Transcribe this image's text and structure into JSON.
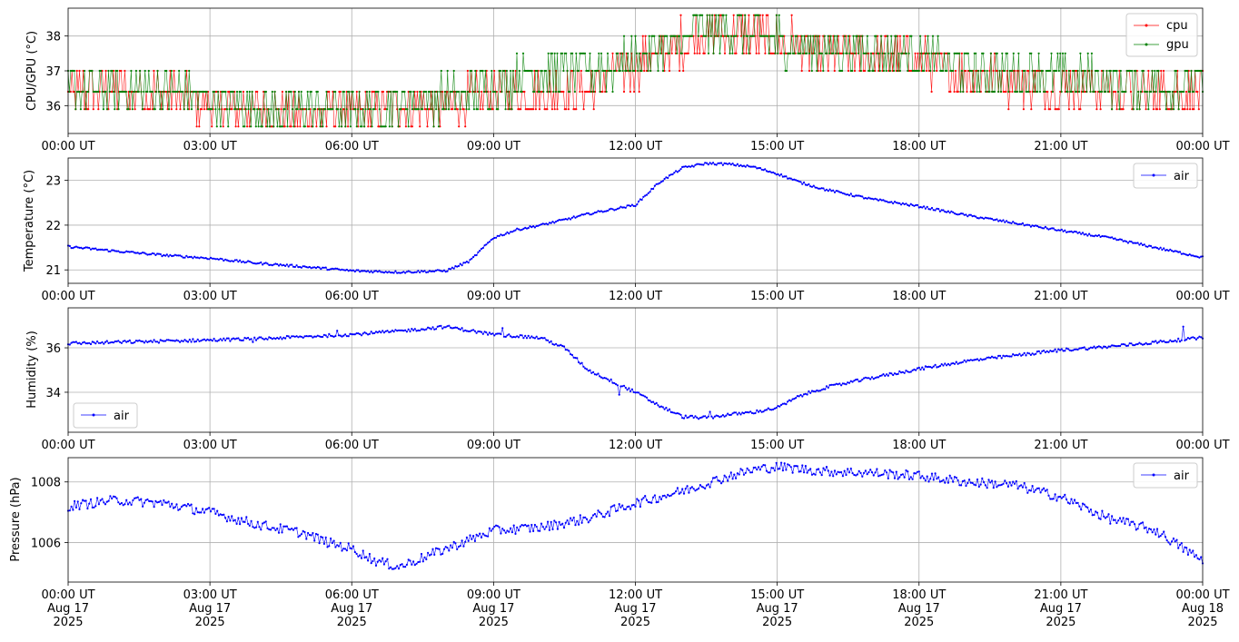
{
  "chart_data": [
    {
      "type": "line",
      "ylabel": "CPU/GPU (°C)",
      "ylim": [
        35.2,
        38.8
      ],
      "yticks": [
        36,
        37,
        38
      ],
      "legend": "top-right",
      "grid": true,
      "xticks": [
        "00:00 UT",
        "03:00 UT",
        "06:00 UT",
        "09:00 UT",
        "12:00 UT",
        "15:00 UT",
        "18:00 UT",
        "21:00 UT",
        "00:00 UT"
      ],
      "series": [
        {
          "name": "cpu",
          "color": "#ff0000",
          "x": [
            0,
            1,
            2,
            3,
            4,
            5,
            6,
            7,
            8,
            9,
            10,
            11,
            12,
            12.5,
            13,
            13.5,
            14,
            14.5,
            15,
            15.5,
            16,
            17,
            18,
            19,
            20,
            21,
            22,
            23,
            24
          ],
          "y": [
            36.4,
            36.4,
            36.4,
            36.0,
            35.9,
            35.8,
            35.8,
            36.0,
            36.0,
            36.4,
            36.4,
            36.5,
            37.2,
            37.5,
            37.8,
            38.0,
            38.0,
            38.0,
            37.9,
            37.7,
            37.5,
            37.5,
            37.3,
            36.9,
            36.7,
            36.6,
            36.5,
            36.4,
            36.4
          ]
        },
        {
          "name": "gpu",
          "color": "#008000",
          "x": [
            0,
            1,
            2,
            3,
            4,
            5,
            6,
            7,
            8,
            9,
            10,
            11,
            12,
            12.5,
            13,
            13.5,
            14,
            14.5,
            15,
            15.5,
            16,
            17,
            18,
            19,
            20,
            21,
            22,
            23,
            24
          ],
          "y": [
            36.5,
            36.5,
            36.5,
            36.2,
            35.9,
            35.9,
            35.9,
            36.1,
            36.2,
            36.6,
            36.9,
            37.0,
            37.3,
            37.6,
            37.9,
            38.1,
            38.1,
            38.0,
            37.9,
            37.7,
            37.6,
            37.6,
            37.4,
            37.0,
            36.9,
            36.8,
            36.7,
            36.6,
            36.6
          ]
        }
      ]
    },
    {
      "type": "line",
      "ylabel": "Temperature (°C)",
      "ylim": [
        20.7,
        23.5
      ],
      "yticks": [
        21,
        22,
        23
      ],
      "legend": "top-right",
      "grid": true,
      "xticks": [
        "00:00 UT",
        "03:00 UT",
        "06:00 UT",
        "09:00 UT",
        "12:00 UT",
        "15:00 UT",
        "18:00 UT",
        "21:00 UT",
        "00:00 UT"
      ],
      "series": [
        {
          "name": "air",
          "color": "#0000ff",
          "x": [
            0,
            1,
            2,
            3,
            4,
            5,
            6,
            7,
            8,
            8.5,
            9,
            9.5,
            10,
            10.5,
            11,
            11.5,
            12,
            12.5,
            13,
            13.5,
            14,
            14.5,
            15,
            15.5,
            16,
            17,
            18,
            19,
            20,
            21,
            22,
            23,
            24
          ],
          "y": [
            21.52,
            21.42,
            21.33,
            21.26,
            21.15,
            21.07,
            20.98,
            20.95,
            20.98,
            21.2,
            21.72,
            21.9,
            22.0,
            22.12,
            22.25,
            22.35,
            22.45,
            22.95,
            23.28,
            23.38,
            23.36,
            23.3,
            23.15,
            22.95,
            22.8,
            22.58,
            22.42,
            22.22,
            22.05,
            21.88,
            21.72,
            21.5,
            21.28
          ]
        }
      ]
    },
    {
      "type": "line",
      "ylabel": "Humidity (%)",
      "ylim": [
        32.2,
        37.8
      ],
      "yticks": [
        34,
        36
      ],
      "legend": "bottom-left",
      "grid": true,
      "xticks": [
        "00:00 UT",
        "03:00 UT",
        "06:00 UT",
        "09:00 UT",
        "12:00 UT",
        "15:00 UT",
        "18:00 UT",
        "21:00 UT",
        "00:00 UT"
      ],
      "series": [
        {
          "name": "air",
          "color": "#0000ff",
          "x": [
            0,
            1,
            2,
            3,
            4,
            5,
            6,
            7,
            8,
            9,
            10,
            10.5,
            11,
            11.5,
            12,
            12.5,
            13,
            13.5,
            14,
            14.5,
            15,
            15.5,
            16,
            17,
            18,
            19,
            20,
            21,
            22,
            23,
            24
          ],
          "y": [
            36.2,
            36.25,
            36.3,
            36.35,
            36.4,
            36.5,
            36.6,
            36.75,
            36.95,
            36.6,
            36.45,
            36.0,
            35.0,
            34.5,
            34.0,
            33.4,
            32.9,
            32.85,
            33.0,
            33.1,
            33.3,
            33.85,
            34.2,
            34.65,
            35.05,
            35.4,
            35.65,
            35.9,
            36.05,
            36.25,
            36.45
          ]
        }
      ]
    },
    {
      "type": "line",
      "ylabel": "Pressure (hPa)",
      "ylim": [
        1004.7,
        1008.8
      ],
      "yticks": [
        1006,
        1008
      ],
      "legend": "top-right",
      "grid": true,
      "xticks": [
        "00:00 UT\nAug 17\n2025",
        "03:00 UT\nAug 17\n2025",
        "06:00 UT\nAug 17\n2025",
        "09:00 UT\nAug 17\n2025",
        "12:00 UT\nAug 17\n2025",
        "15:00 UT\nAug 17\n2025",
        "18:00 UT\nAug 17\n2025",
        "21:00 UT\nAug 17\n2025",
        "00:00 UT\nAug 18\n2025"
      ],
      "series": [
        {
          "name": "air",
          "color": "#0000ff",
          "x": [
            0,
            1,
            2,
            3,
            4,
            5,
            5.5,
            6,
            6.5,
            7,
            8,
            9,
            10,
            11,
            12,
            13,
            14,
            14.5,
            15,
            16,
            17,
            18,
            19,
            20,
            21,
            22,
            23,
            23.5,
            24
          ],
          "y": [
            1007.2,
            1007.4,
            1007.3,
            1007.0,
            1006.6,
            1006.3,
            1006.0,
            1005.8,
            1005.4,
            1005.2,
            1005.8,
            1006.4,
            1006.5,
            1006.8,
            1007.3,
            1007.7,
            1008.2,
            1008.4,
            1008.5,
            1008.35,
            1008.3,
            1008.2,
            1008.0,
            1007.9,
            1007.5,
            1006.8,
            1006.4,
            1005.9,
            1005.4
          ]
        }
      ]
    }
  ]
}
